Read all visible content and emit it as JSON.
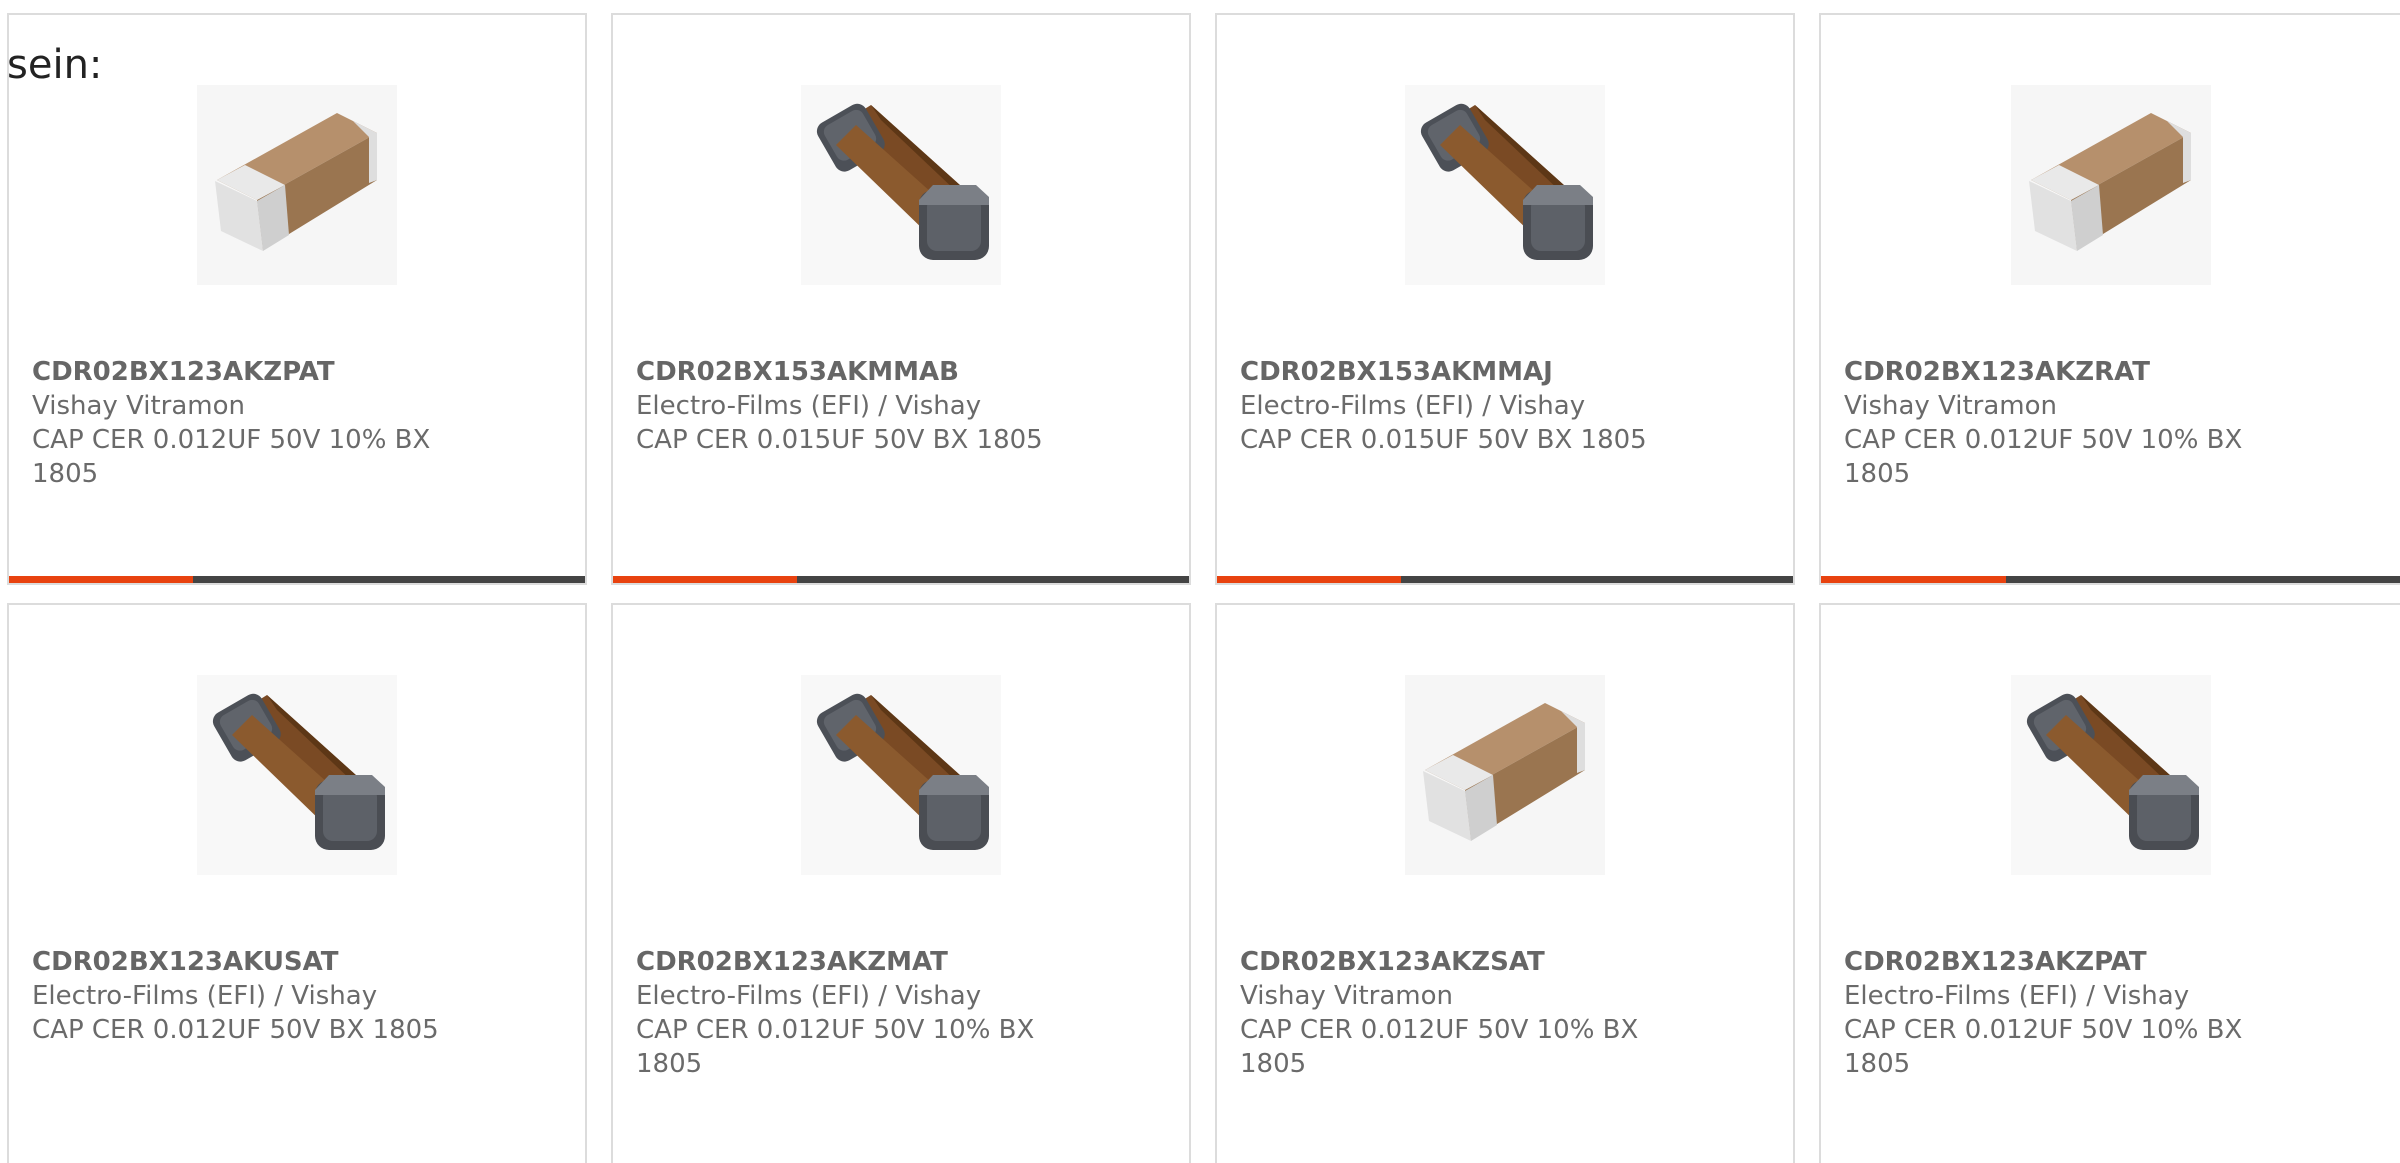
{
  "intro_text": "sein:",
  "accent_color": "#e8420f",
  "bar_color": "#444444",
  "cards": [
    {
      "part": "CDR02BX123AKZPAT",
      "mfr": "Vishay Vitramon",
      "desc": "CAP CER 0.012UF 50V 10% BX 1805",
      "style": "light",
      "progress": 0.32
    },
    {
      "part": "CDR02BX153AKMMAB",
      "mfr": "Electro-Films (EFI) / Vishay",
      "desc": "CAP CER 0.015UF 50V BX 1805",
      "style": "dark",
      "progress": 0.32
    },
    {
      "part": "CDR02BX153AKMMAJ",
      "mfr": "Electro-Films (EFI) / Vishay",
      "desc": "CAP CER 0.015UF 50V BX 1805",
      "style": "dark",
      "progress": 0.32
    },
    {
      "part": "CDR02BX123AKZRAT",
      "mfr": "Vishay Vitramon",
      "desc": "CAP CER 0.012UF 50V 10% BX 1805",
      "style": "light",
      "progress": 0.32
    },
    {
      "part": "CDR02BX123AKUSAT",
      "mfr": "Electro-Films (EFI) / Vishay",
      "desc": "CAP CER 0.012UF 50V BX 1805",
      "style": "dark",
      "progress": null
    },
    {
      "part": "CDR02BX123AKZMAT",
      "mfr": "Electro-Films (EFI) / Vishay",
      "desc": "CAP CER 0.012UF 50V 10% BX 1805",
      "style": "dark",
      "progress": null
    },
    {
      "part": "CDR02BX123AKZSAT",
      "mfr": "Vishay Vitramon",
      "desc": "CAP CER 0.012UF 50V 10% BX 1805",
      "style": "light",
      "progress": null
    },
    {
      "part": "CDR02BX123AKZPAT",
      "mfr": "Electro-Films (EFI) / Vishay",
      "desc": "CAP CER 0.012UF 50V 10% BX 1805",
      "style": "dark",
      "progress": null
    }
  ]
}
